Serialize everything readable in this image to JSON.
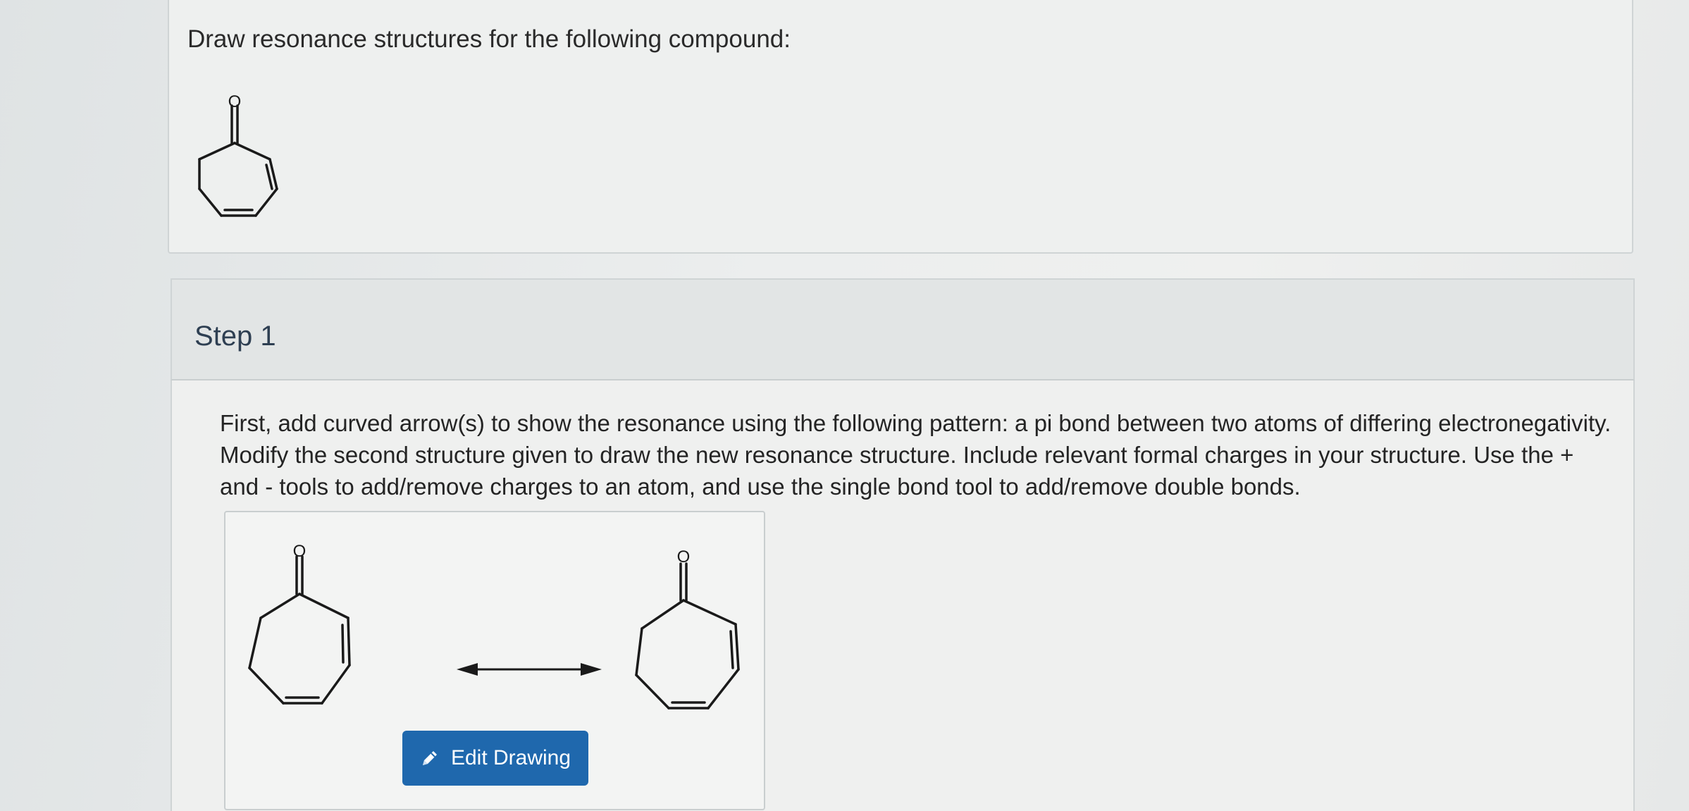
{
  "question": {
    "text": "Draw resonance structures for the following compound:",
    "molecule_atom_label": "O"
  },
  "step": {
    "title": "Step 1",
    "instructions": "First, add curved arrow(s) to show the resonance using the following pattern: a pi bond between two atoms of differing electronegativity. Modify the second structure given to draw the new resonance structure. Include relevant formal charges in your structure. Use the + and - tools to add/remove charges to an atom, and use the single bond tool to add/remove double bonds."
  },
  "drawing": {
    "left_molecule_atom_label": "O",
    "right_molecule_atom_label": "O",
    "arrow_icon": "double-headed-resonance-arrow",
    "edit_button": {
      "label": "Edit Drawing",
      "icon": "pencil-icon",
      "color": "#1f68ad"
    }
  }
}
